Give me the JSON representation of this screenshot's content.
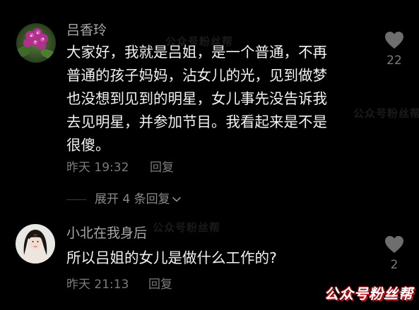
{
  "comments": [
    {
      "username": "吕香玲",
      "text": "大家好，我就是吕姐，是一个普通，不再\n普通的孩子妈妈，沾女儿的光，见到做梦\n也没想到见到的明星，女儿事先没告诉我\n去见明星，并参加节目。我看起来是不是\n很傻。",
      "time": "昨天 19:32",
      "reply_label": "回复",
      "like_count": "22",
      "expand_replies": "展开 4 条回复"
    },
    {
      "username": "小北在我身后",
      "text": "所以吕姐的女儿是做什么工作的?",
      "time": "昨天 21:13",
      "reply_label": "回复",
      "like_count": "2"
    }
  ],
  "watermarks": {
    "faint": "公众号粉丝帮",
    "brand": "公众号粉丝帮"
  },
  "colors": {
    "background": "#000000",
    "username": "#a6a6a6",
    "body_text": "#f2f2f2",
    "meta_text": "#7b7b7b",
    "brand_red": "#c4121a"
  }
}
